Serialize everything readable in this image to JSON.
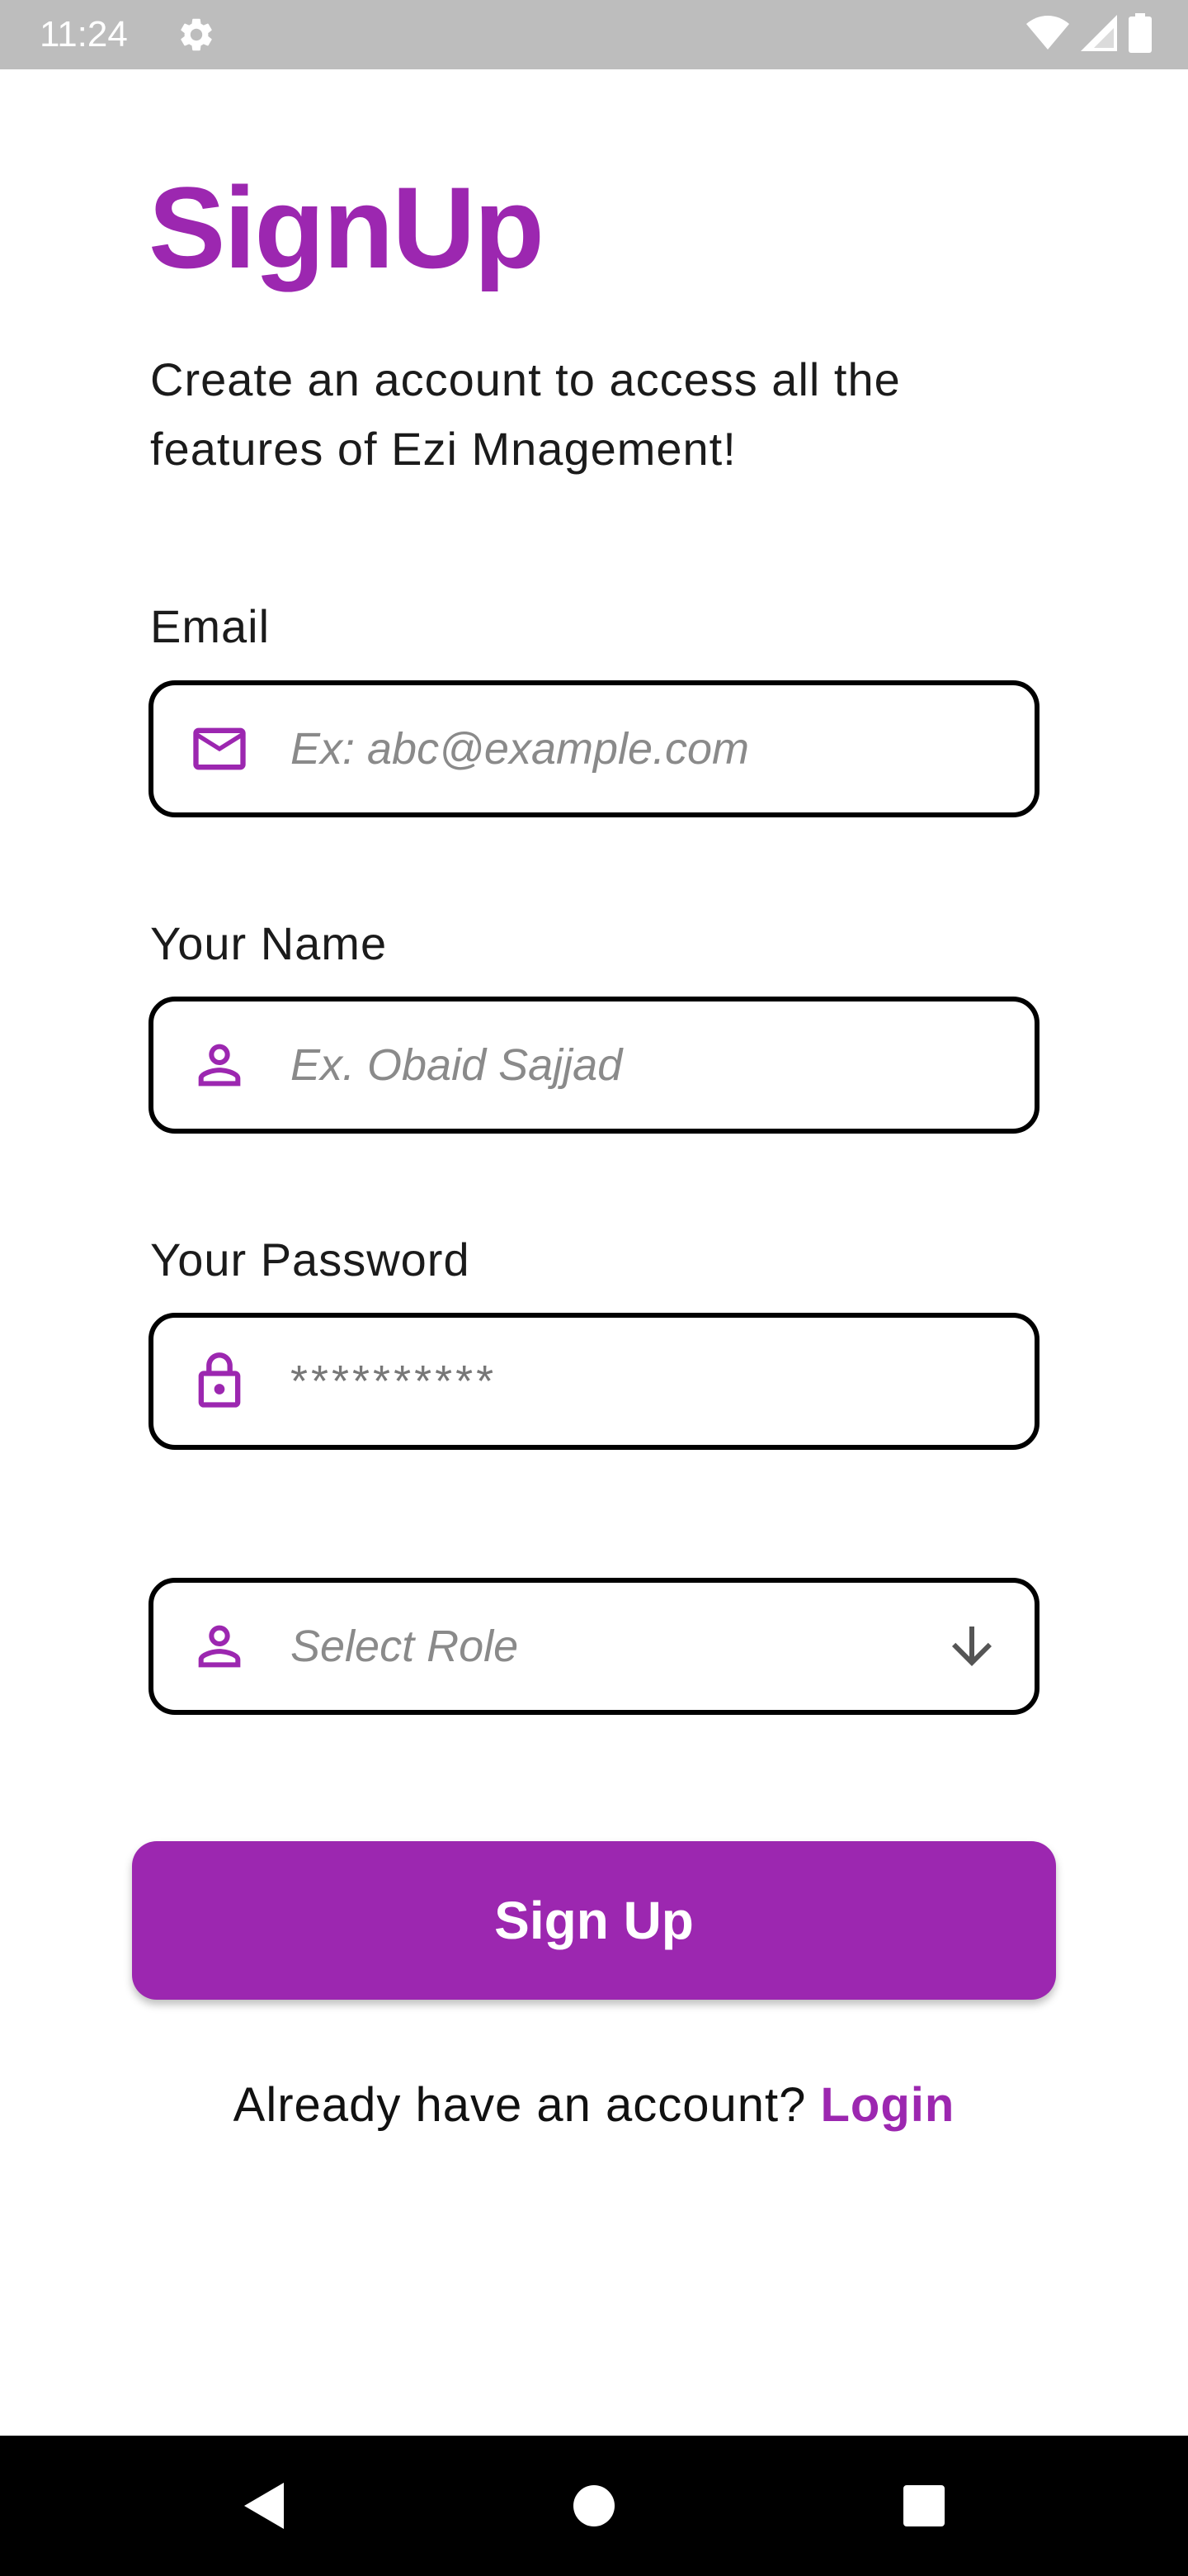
{
  "status_bar": {
    "time": "11:24",
    "icons": [
      "gear-icon",
      "wifi-icon",
      "cell-signal-icon",
      "battery-icon"
    ]
  },
  "colors": {
    "accent": "#9c27b0",
    "status_bar_bg": "#bdbdbd",
    "nav_bar_bg": "#000000"
  },
  "page": {
    "title": "SignUp",
    "subtitle": "Create an account to access all the features of Ezi Mnagement!"
  },
  "form": {
    "email": {
      "label": "Email",
      "placeholder": "Ex: abc@example.com",
      "icon": "mail-icon"
    },
    "name": {
      "label": "Your Name",
      "placeholder": "Ex. Obaid Sajjad",
      "icon": "person-icon"
    },
    "password": {
      "label": "Your Password",
      "placeholder": "**********",
      "icon": "lock-icon"
    },
    "role": {
      "placeholder": "Select Role",
      "icon": "person-icon",
      "dropdown_icon": "arrow-down-icon"
    },
    "submit_label": "Sign Up"
  },
  "footer": {
    "prompt": "Already have an account? ",
    "login_label": "Login"
  },
  "nav_bar": {
    "buttons": [
      "back-icon",
      "home-icon",
      "recents-icon"
    ]
  }
}
